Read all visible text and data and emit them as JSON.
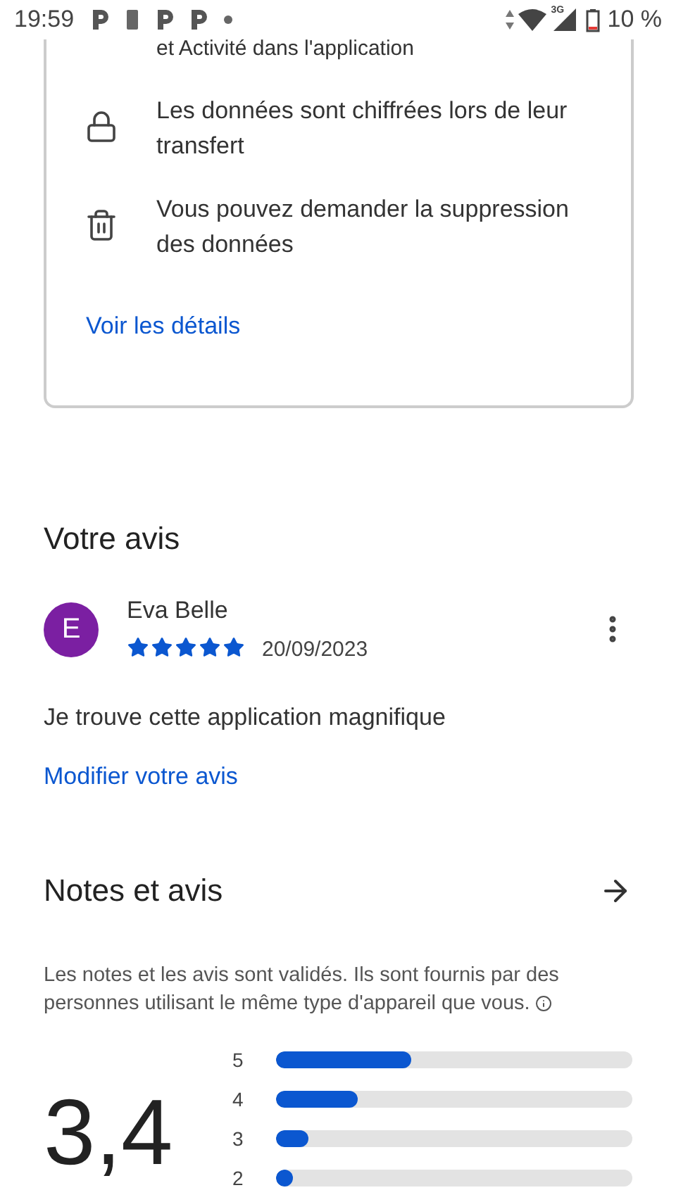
{
  "status_bar": {
    "time": "19:59",
    "battery": "10 %",
    "network": "3G"
  },
  "data_safety": {
    "items": [
      {
        "kind": "partial",
        "text": "et Activité dans l'application"
      },
      {
        "kind": "lock",
        "text": "Les données sont chiffrées lors de leur transfert"
      },
      {
        "kind": "trash",
        "text": "Vous pouvez demander la suppression des données"
      }
    ],
    "link": "Voir les détails"
  },
  "my_review": {
    "title": "Votre avis",
    "avatar": "E",
    "name": "Eva Belle",
    "stars": 5,
    "date": "20/09/2023",
    "text": "Je trouve cette application magnifique",
    "edit_link": "Modifier votre avis"
  },
  "ratings": {
    "title": "Notes et avis",
    "note": "Les notes et les avis sont validés. Ils sont fournis par des personnes utilisant le même type d'appareil que vous.",
    "score": "3,4",
    "bars": [
      {
        "label": "5",
        "level": 0.38
      },
      {
        "label": "4",
        "level": 0.23
      },
      {
        "label": "3",
        "level": 0.09
      },
      {
        "label": "2",
        "level": 0.04
      }
    ]
  }
}
